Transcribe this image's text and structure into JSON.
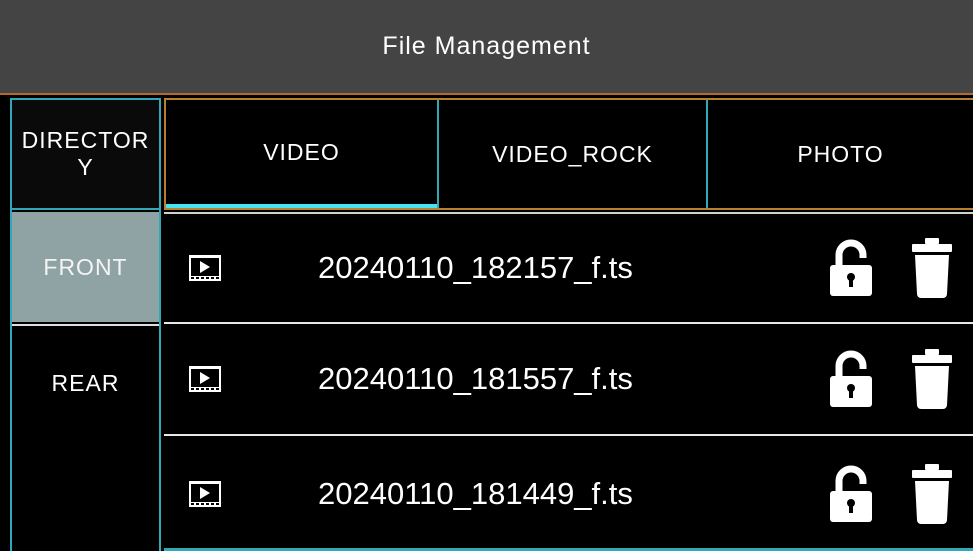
{
  "title": "File Management",
  "directory": {
    "header": "DIRECTORY",
    "items": [
      {
        "label": "FRONT",
        "selected": true
      },
      {
        "label": "REAR",
        "selected": false
      }
    ]
  },
  "tabs": [
    {
      "label": "VIDEO",
      "selected": true
    },
    {
      "label": "VIDEO_ROCK",
      "selected": false
    },
    {
      "label": "PHOTO",
      "selected": false
    }
  ],
  "files": [
    {
      "name": "20240110_182157_f.ts",
      "type_icon": "video-file-icon",
      "lock_icon": "unlock-icon",
      "delete_icon": "trash-icon"
    },
    {
      "name": "20240110_181557_f.ts",
      "type_icon": "video-file-icon",
      "lock_icon": "unlock-icon",
      "delete_icon": "trash-icon"
    },
    {
      "name": "20240110_181449_f.ts",
      "type_icon": "video-file-icon",
      "lock_icon": "unlock-icon",
      "delete_icon": "trash-icon"
    }
  ],
  "colors": {
    "title_bg": "#444444",
    "accent_cyan": "#46e3f3",
    "selected_dir_bg": "#8fa2a4",
    "border_gold": "#b8802a"
  }
}
